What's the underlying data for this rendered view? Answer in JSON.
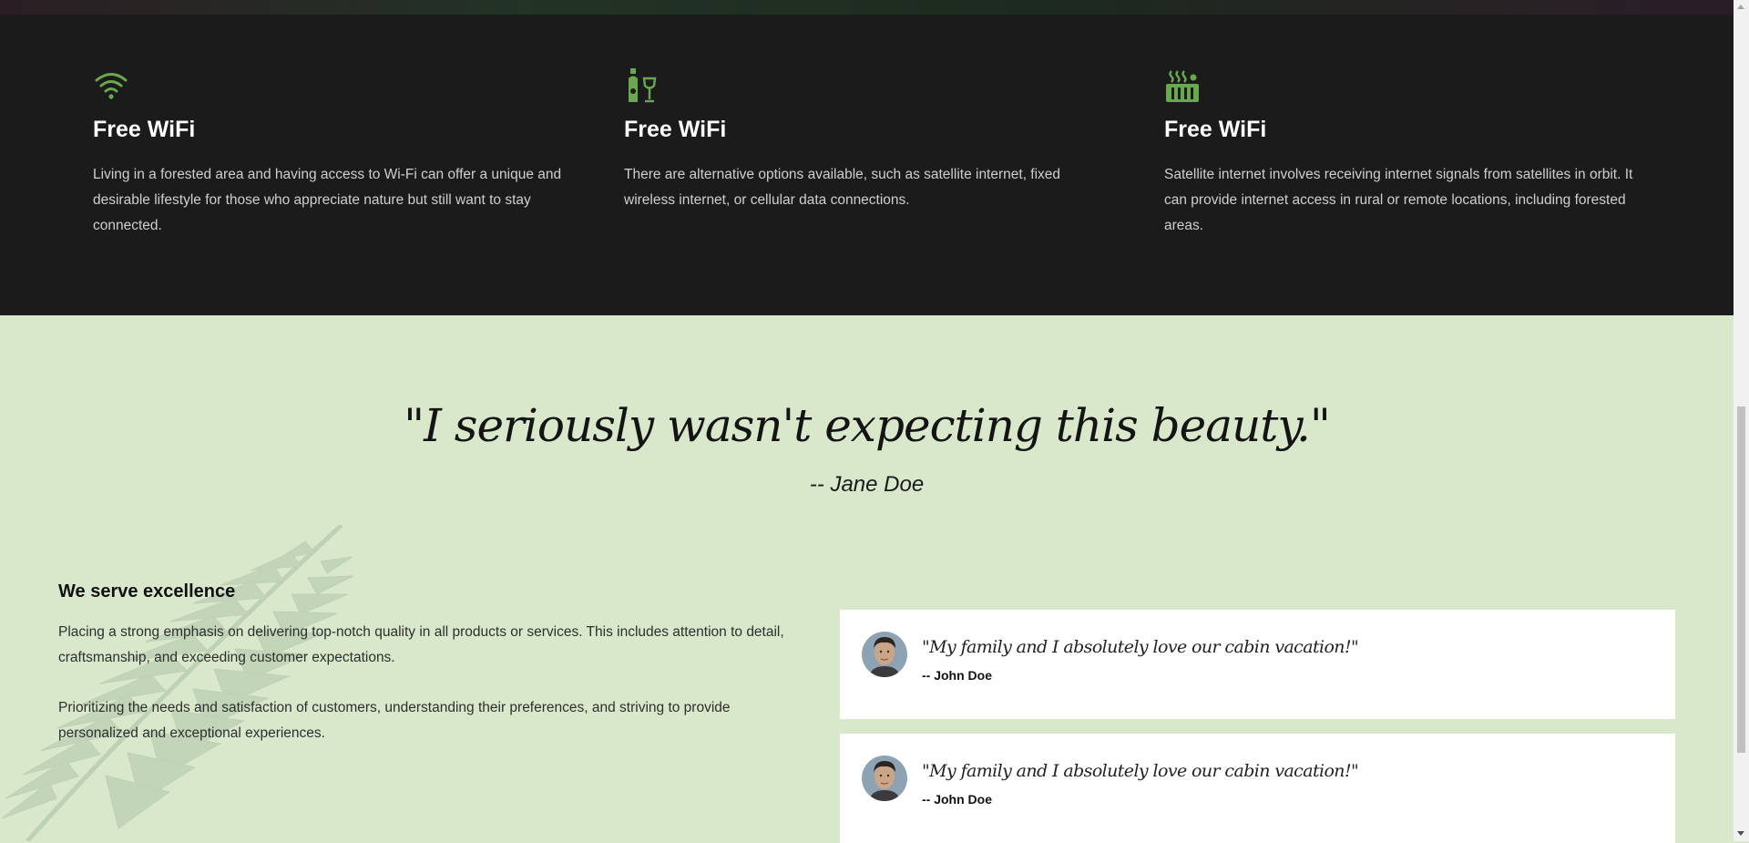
{
  "colors": {
    "accent": "#6aa84f",
    "dark_bg": "#1b1b1b",
    "light_bg": "#d9e8cb"
  },
  "features": [
    {
      "icon": "wifi-icon",
      "title": "Free WiFi",
      "text": "Living in a forested area and having access to Wi-Fi can offer a unique and desirable lifestyle for those who appreciate nature but still want to stay connected."
    },
    {
      "icon": "wine-icon",
      "title": "Free WiFi",
      "text": "There are alternative options available, such as satellite internet, fixed wireless internet, or cellular data connections."
    },
    {
      "icon": "hot-tub-icon",
      "title": "Free WiFi",
      "text": "Satellite internet involves receiving internet signals from satellites in orbit. It can provide internet access in rural or remote locations, including forested areas."
    }
  ],
  "highlight": {
    "quote": "\"I seriously wasn't expecting this beauty.\"",
    "author": "-- Jane Doe"
  },
  "serve": {
    "heading": "We serve excellence",
    "paragraph1": "Placing a strong emphasis on delivering top-notch quality in all products or services. This includes attention to detail, craftsmanship, and exceeding customer expectations.",
    "paragraph2": "Prioritizing the needs and satisfaction of customers, understanding their preferences, and striving to provide personalized and exceptional experiences."
  },
  "testimonials": [
    {
      "quote": "\"My family and I absolutely love our cabin vacation!\"",
      "author": "-- John Doe"
    },
    {
      "quote": "\"My family and I absolutely love our cabin vacation!\"",
      "author": "-- John Doe"
    }
  ]
}
